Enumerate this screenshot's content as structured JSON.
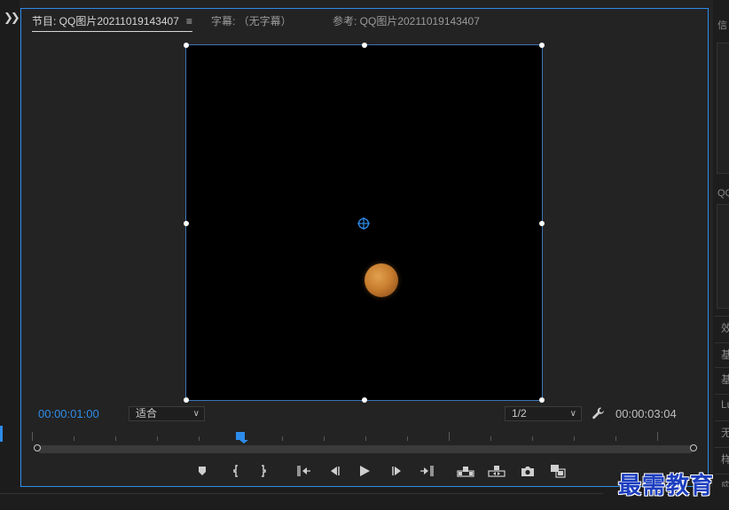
{
  "left_panel": {
    "expand_icon": "double-chevron-right-icon"
  },
  "tabs": [
    {
      "label": "节目: QQ图片20211019143407",
      "active": true,
      "menu_icon": "hamburger-menu-icon"
    },
    {
      "label": "字幕: （无字幕）",
      "active": false
    },
    {
      "label": "参考: QQ图片20211019143407",
      "active": false
    }
  ],
  "monitor": {
    "current_timecode": "00:00:01:00",
    "zoom_select": {
      "value": "适合"
    },
    "resolution_select": {
      "value": "1/2"
    },
    "duration_timecode": "00:00:03:04",
    "settings_icon": "wrench-icon"
  },
  "transport_buttons": [
    {
      "name": "add-marker-button",
      "icon": "marker-icon"
    },
    {
      "name": "mark-in-button",
      "icon": "mark-in-icon"
    },
    {
      "name": "mark-out-button",
      "icon": "mark-out-icon"
    },
    {
      "name": "go-to-in-button",
      "icon": "go-to-in-icon"
    },
    {
      "name": "step-back-button",
      "icon": "step-back-icon"
    },
    {
      "name": "play-button",
      "icon": "play-icon"
    },
    {
      "name": "step-forward-button",
      "icon": "step-forward-icon"
    },
    {
      "name": "go-to-out-button",
      "icon": "go-to-out-icon"
    },
    {
      "name": "lift-button",
      "icon": "lift-icon"
    },
    {
      "name": "extract-button",
      "icon": "extract-icon"
    },
    {
      "name": "export-frame-button",
      "icon": "camera-icon"
    },
    {
      "name": "comparison-view-button",
      "icon": "comparison-view-icon"
    }
  ],
  "right_panel": {
    "labels": [
      "信",
      "QQ",
      "效",
      "基",
      "基",
      "Lu",
      "无",
      "样",
      "应"
    ]
  },
  "watermark": {
    "text": "最需教育"
  },
  "colors": {
    "accent": "#2d8ceb",
    "background": "#232323",
    "watermark": "#1d3fbf"
  }
}
